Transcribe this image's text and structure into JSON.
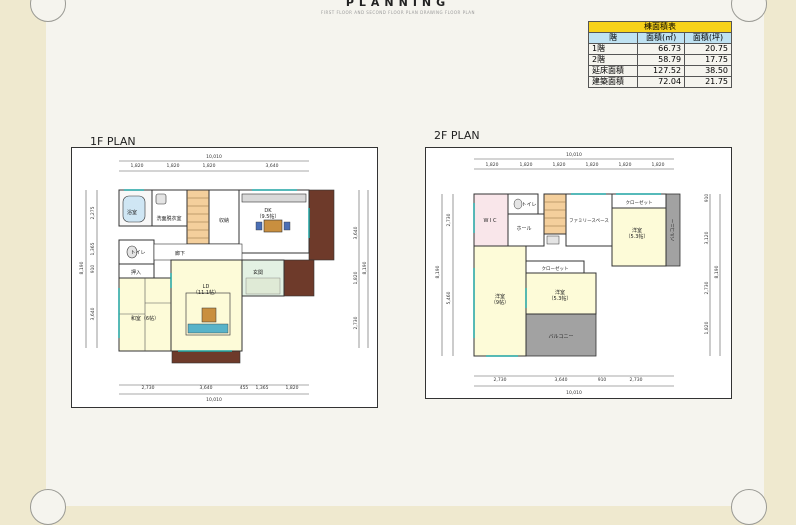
{
  "header": {
    "title": "PLANNING",
    "subtitle": "FIRST FLOOR AND SECOND FLOOR PLAN DRAWING FLOOR PLAN"
  },
  "area_table": {
    "caption": "棟面積表",
    "headers": [
      "階",
      "面積(㎡)",
      "面積(坪)"
    ],
    "rows": [
      {
        "label": "1階",
        "m2": "66.73",
        "tsubo": "20.75"
      },
      {
        "label": "2階",
        "m2": "58.79",
        "tsubo": "17.75"
      },
      {
        "label": "延床面積",
        "m2": "127.52",
        "tsubo": "38.50"
      },
      {
        "label": "建築面積",
        "m2": "72.04",
        "tsubo": "21.75"
      }
    ]
  },
  "plan1": {
    "title": "1F PLAN",
    "top_total": "10,010",
    "top_dims": [
      "1,820",
      "1,820",
      "1,820",
      "3,640"
    ],
    "bottom_dims": [
      "2,730",
      "3,640",
      "455",
      "1,365",
      "1,820"
    ],
    "bottom_total": "10,010",
    "left_dims": [
      "2,275",
      "1,365",
      "910",
      "3,640"
    ],
    "left_total": "8,190",
    "right_dims": [
      "3,640",
      "1,820",
      "2,730"
    ],
    "right_total": "8,190",
    "rooms": {
      "bath": "浴室",
      "washroom": "洗面脱衣室",
      "toilet": "トイレ",
      "closet": "押入",
      "washitsu": "和室（6帖）",
      "hall": "廊下",
      "storage": "収納",
      "kitchen": "DK\n（9.5帖）",
      "genkan": "玄関",
      "ldk": "LD\n（11.1帖）"
    }
  },
  "plan2": {
    "title": "2F PLAN",
    "top_total": "10,010",
    "top_dims": [
      "1,820",
      "1,820",
      "1,820",
      "1,820",
      "1,820",
      "1,820"
    ],
    "bottom_dims": [
      "2,730",
      "3,640",
      "910",
      "2,730"
    ],
    "bottom_total": "10,010",
    "left_dims": [
      "2,730",
      "5,460"
    ],
    "left_total": "8,190",
    "right_dims": [
      "910",
      "3,120",
      "2,730",
      "1,820"
    ],
    "right_total": "8,190",
    "rooms": {
      "wic": "W I C",
      "toilet": "トイレ",
      "hall": "ホール",
      "family_space": "ファミリースペース",
      "closet_top": "クローゼット",
      "room_ne": "洋室\n（5.3帖）",
      "balcony_right": "バルコニー",
      "room_west": "洋室\n（9帖）",
      "room_center": "洋室\n（5.3帖）",
      "closet_mid": "クローゼット",
      "balcony_bottom": "バルコニー"
    }
  }
}
